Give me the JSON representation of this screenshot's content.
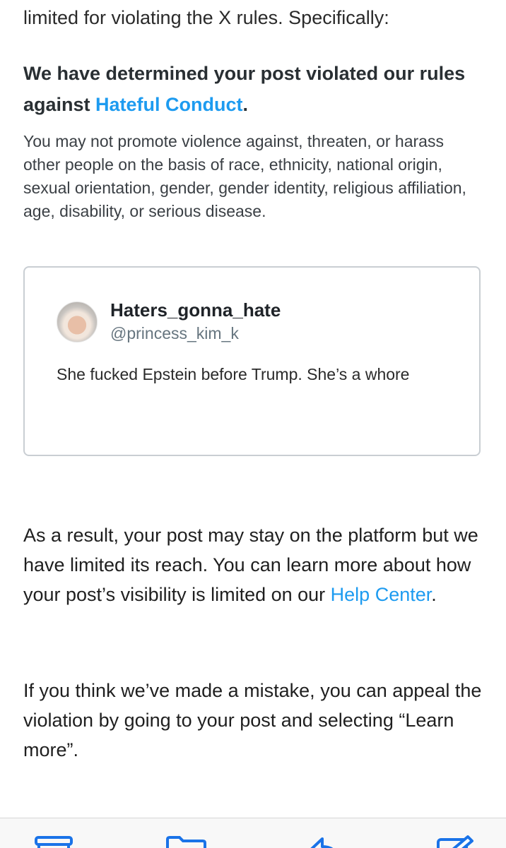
{
  "email": {
    "clipped_line": "limited for violating the X rules. Specifically:",
    "headline_prefix": "We have determined your post violated our rules against ",
    "headline_link": "Hateful Conduct",
    "headline_suffix": ".",
    "rule_description": "You may not promote violence against, threaten, or harass other people on the basis of race, ethnicity, national origin, sexual orientation, gender, gender identity, religious affiliation, age, disability, or serious disease.",
    "post": {
      "display_name": "Haters_gonna_hate",
      "handle": "@princess_kim_k",
      "text": "She fucked Epstein before Trump. She’s a whore"
    },
    "result_prefix": "As a result, your post may stay on the platform but we have limited its reach. You can learn more about how your post’s visibility is limited on our ",
    "result_link": "Help Center",
    "result_suffix": ".",
    "appeal_text": "If you think we’ve made a mistake, you can appeal the violation by going to your post and selecting “Learn more”."
  },
  "toolbar": {
    "accent_color": "#1a73e8",
    "icons": [
      "archive-icon",
      "folder-icon",
      "reply-icon",
      "compose-icon"
    ]
  }
}
